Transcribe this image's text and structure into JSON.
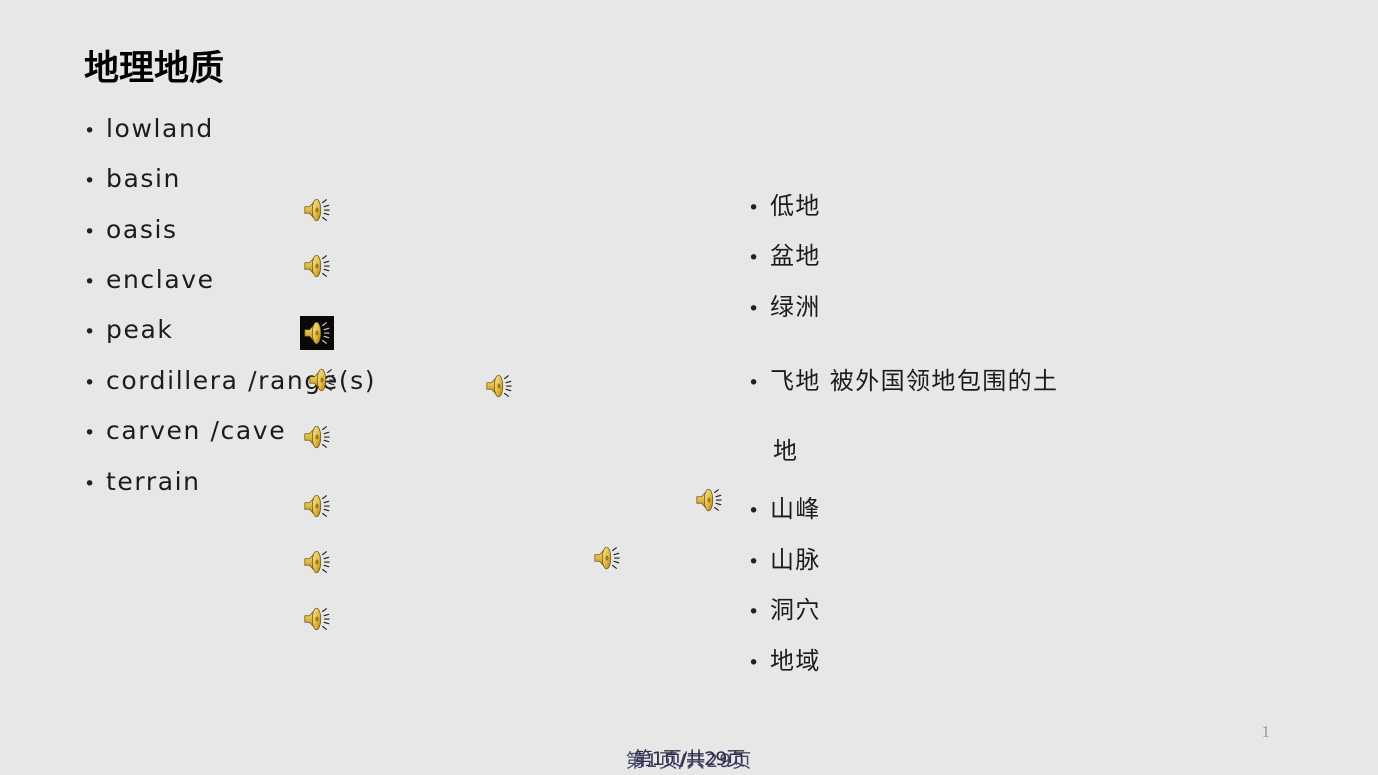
{
  "slide": {
    "title": "地理地质",
    "background_color": "#e7e7e7",
    "text_color": "#1c1c1c",
    "page_number": "1",
    "footer_primary": "第1页/共29页",
    "footer_secondary": "第1页/共29页"
  },
  "english_column": {
    "bullet_char": "•",
    "items": [
      {
        "label": "lowland"
      },
      {
        "label": "basin"
      },
      {
        "label": "oasis"
      },
      {
        "label": "enclave"
      },
      {
        "label": "peak"
      },
      {
        "label": "cordillera /range(s)"
      },
      {
        "label": "carven /cave"
      },
      {
        "label": "terrain"
      }
    ]
  },
  "chinese_column": {
    "bullet_char": "•",
    "items": [
      {
        "label": "低地"
      },
      {
        "label": "盆地"
      },
      {
        "label": "绿洲"
      },
      {
        "label": "飞地 被外国领地包围的土"
      },
      {
        "label": "山峰"
      },
      {
        "label": "山脉"
      },
      {
        "label": "洞穴"
      },
      {
        "label": "地域"
      }
    ],
    "continuation_line": "地"
  },
  "audio_icons": {
    "icon_name": "speaker-icon",
    "body_color": "#e8c04a",
    "highlight_color": "#f7e7a0",
    "shadow_color": "#a8821f",
    "wave_color": "#2b2b2b",
    "framed_background": "#090806",
    "items": [
      {
        "id": "speaker-1",
        "framed": false
      },
      {
        "id": "speaker-2",
        "framed": false
      },
      {
        "id": "speaker-3",
        "framed": true
      },
      {
        "id": "speaker-4",
        "framed": false
      },
      {
        "id": "speaker-5",
        "framed": false
      },
      {
        "id": "speaker-6",
        "framed": false
      },
      {
        "id": "speaker-7",
        "framed": false
      },
      {
        "id": "speaker-8",
        "framed": false
      },
      {
        "id": "speaker-9",
        "framed": false
      },
      {
        "id": "speaker-10",
        "framed": false
      },
      {
        "id": "speaker-11",
        "framed": false
      }
    ]
  }
}
